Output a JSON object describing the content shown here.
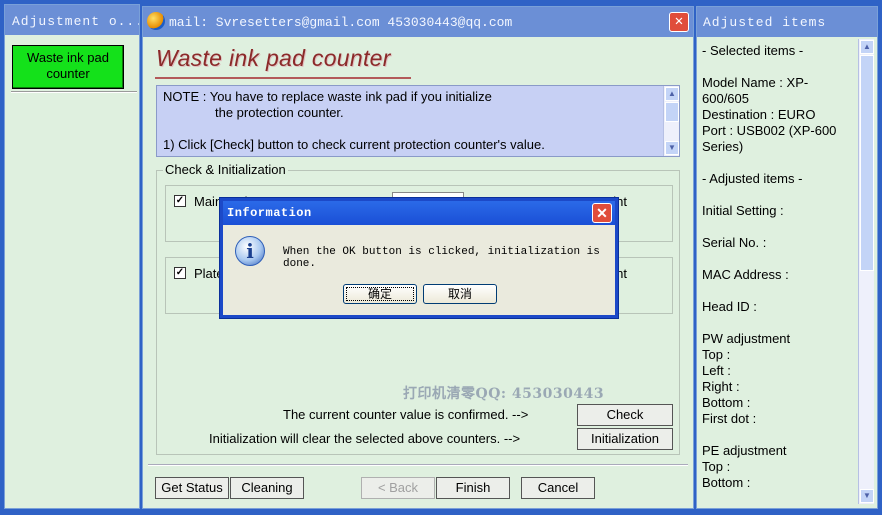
{
  "left_panel": {
    "title": "Adjustment o...",
    "waste_button": "Waste ink pad counter"
  },
  "main_window": {
    "title": "mail: Svresetters@gmail.com  453030443@qq.com",
    "close": "✕",
    "page_title": "Waste ink pad counter",
    "note": {
      "line1": "NOTE : You have to replace waste ink pad if you initialize",
      "line2": "the protection counter.",
      "line3": "1) Click [Check] button to check current protection counter's value."
    },
    "group_label": "Check & Initialization",
    "rows": [
      {
        "checked": "✓",
        "label": "Main pad counter",
        "right": "oint"
      },
      {
        "checked": "✓",
        "label": "Platen pad counter",
        "right": "oint"
      }
    ],
    "watermark": "打印机清零QQ: 453030443",
    "confirmed_text": "The current counter value is confirmed. -->",
    "init_text": "Initialization will clear the selected above counters. -->",
    "check_button": "Check",
    "init_button": "Initialization",
    "buttons": {
      "get_status": "Get Status",
      "cleaning": "Cleaning",
      "back": "< Back",
      "finish": "Finish",
      "cancel": "Cancel"
    }
  },
  "right_panel": {
    "title": "Adjusted items",
    "selected_header": "- Selected items -",
    "model_line1": "Model Name : XP-",
    "model_line2": "600/605",
    "destination": "Destination : EURO",
    "port_line1": "Port : USB002 (XP-600",
    "port_line2": "Series)",
    "adjusted_header": "- Adjusted items -",
    "initial_setting": "Initial Setting :",
    "serial_no": "Serial No. :",
    "mac_address": "MAC Address :",
    "head_id": "Head ID :",
    "pw_adjustment": "PW adjustment",
    "pw_top": "Top :",
    "pw_left": "Left :",
    "pw_right": "Right :",
    "pw_bottom": "Bottom :",
    "first_dot": "First dot :",
    "pe_adjustment": "PE adjustment",
    "pe_top": "Top :",
    "pe_bottom": "Bottom :"
  },
  "dialog": {
    "title": "Information",
    "message": "When the OK button is clicked, initialization is done.",
    "ok": "确定",
    "cancel": "取消",
    "icon": "info-icon"
  }
}
